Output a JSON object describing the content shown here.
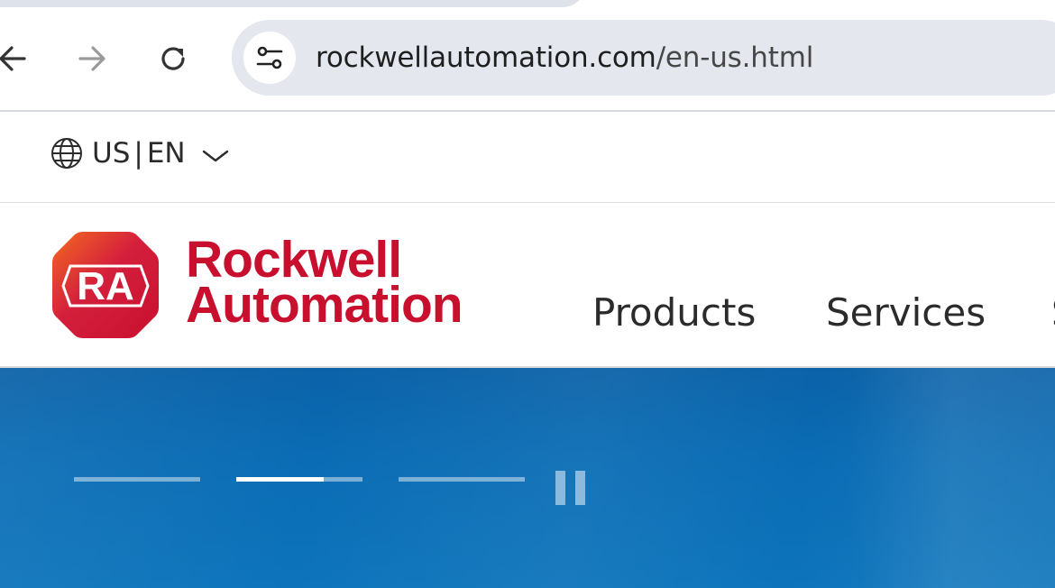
{
  "browser": {
    "url_host": "rockwellautomation.com",
    "url_path": "/en-us.html",
    "icons": [
      "back-arrow-icon",
      "forward-arrow-icon",
      "reload-icon",
      "site-settings-icon"
    ]
  },
  "utility_bar": {
    "country": "US",
    "separator": "|",
    "language": "EN",
    "icons": [
      "globe-icon",
      "chevron-down-icon"
    ]
  },
  "header": {
    "logo": {
      "monogram": "RA",
      "line1": "Rockwell",
      "line2": "Automation"
    },
    "nav": [
      {
        "label": "Products"
      },
      {
        "label": "Services"
      },
      {
        "label": "S"
      }
    ]
  },
  "hero": {
    "slides": [
      {
        "progress": 0
      },
      {
        "progress": 0.69
      },
      {
        "progress": 0
      }
    ],
    "pause_icon": "pause-icon"
  },
  "colors": {
    "brand_red": "#c8102e",
    "brand_orange": "#f26a21",
    "hero_blue": "#0a6cb4",
    "omnibox_bg": "#e4e8ee"
  }
}
